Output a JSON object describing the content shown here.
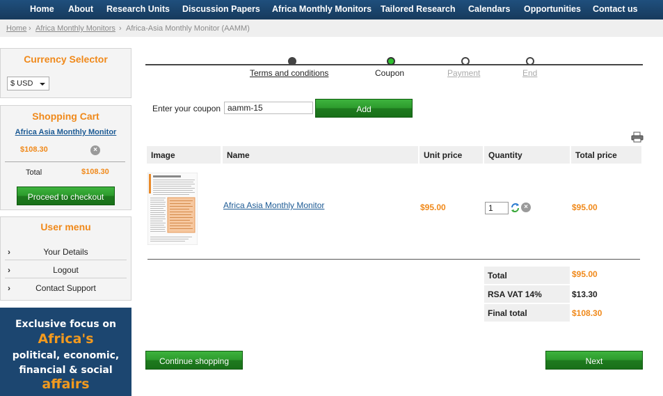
{
  "nav": {
    "items": [
      "Home",
      "About",
      "Research Units",
      "Discussion Papers",
      "Africa Monthly Monitors",
      "Tailored Research",
      "Calendars",
      "Opportunities",
      "Contact us"
    ]
  },
  "breadcrumb": {
    "home": "Home",
    "sep1": "›",
    "section": "Africa Monthly Monitors",
    "sep2": "›",
    "current": "Africa-Asia Monthly Monitor (AAMM)"
  },
  "currency": {
    "title": "Currency Selector",
    "selected": "$ USD"
  },
  "cart": {
    "title": "Shopping Cart",
    "item_name": "Africa Asia Monthly Monitor",
    "item_price": "$108.30",
    "total_label": "Total",
    "total_value": "$108.30",
    "checkout_label": "Proceed to checkout"
  },
  "user_menu": {
    "title": "User menu",
    "items": [
      "Your Details",
      "Logout",
      "Contact Support"
    ]
  },
  "promo": {
    "line1": "Exclusive focus on",
    "line2": "Africa's",
    "line3": "political, economic,",
    "line4": "financial & social",
    "line5": "affairs"
  },
  "steps": [
    {
      "label": "Terms and conditions",
      "state": "done"
    },
    {
      "label": "Coupon",
      "state": "current"
    },
    {
      "label": "Payment",
      "state": "pending"
    },
    {
      "label": "End",
      "state": "pending"
    }
  ],
  "coupon": {
    "label": "Enter your coupon",
    "value": "aamm-15",
    "add_label": "Add"
  },
  "table": {
    "headers": [
      "Image",
      "Name",
      "Unit price",
      "Quantity",
      "Total price"
    ],
    "rows": [
      {
        "name": "Africa Asia Monthly Monitor",
        "unit_price": "$95.00",
        "quantity": "1",
        "total_price": "$95.00"
      }
    ]
  },
  "summary": {
    "total_label": "Total",
    "total_value": "$95.00",
    "vat_label": "RSA VAT 14%",
    "vat_value": "$13.30",
    "final_label": "Final total",
    "final_value": "$108.30"
  },
  "buttons": {
    "continue": "Continue shopping",
    "next": "Next"
  },
  "colors": {
    "nav_bg": "#1f4f7d",
    "accent_orange": "#f0891a",
    "button_green": "#2c9a2c",
    "link_blue": "#1c5a94"
  }
}
